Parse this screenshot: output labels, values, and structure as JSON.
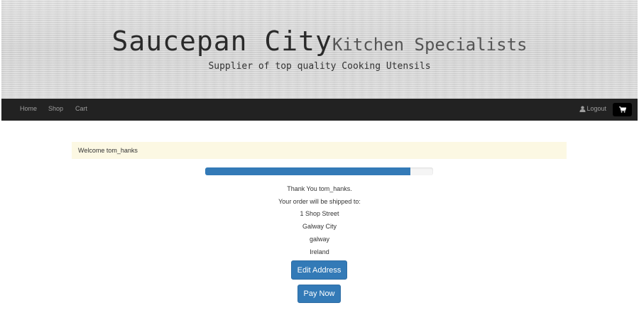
{
  "header": {
    "site_name": "Saucepan City",
    "site_subtitle": "Kitchen Specialists",
    "tagline": "Supplier of top quality Cooking Utensils"
  },
  "nav": {
    "links": [
      {
        "label": "Home"
      },
      {
        "label": "Shop"
      },
      {
        "label": "Cart"
      }
    ],
    "logout_label": "Logout",
    "user_icon": "user-icon",
    "cart_icon": "shopping-cart-icon"
  },
  "alert": {
    "welcome_text": "Welcome tom_hanks"
  },
  "checkout": {
    "progress_fraction": 0.9,
    "thank_you": "Thank You tom_hanks.",
    "shipped_to": "Your order will be shipped to:",
    "address": {
      "line1": "1 Shop Street",
      "city": "Galway City",
      "county": "galway",
      "country": "Ireland"
    },
    "edit_address_label": "Edit Address",
    "pay_now_label": "Pay Now"
  },
  "colors": {
    "primary": "#337ab7",
    "navbar": "#222222",
    "alert_bg": "#fcf8e3"
  }
}
